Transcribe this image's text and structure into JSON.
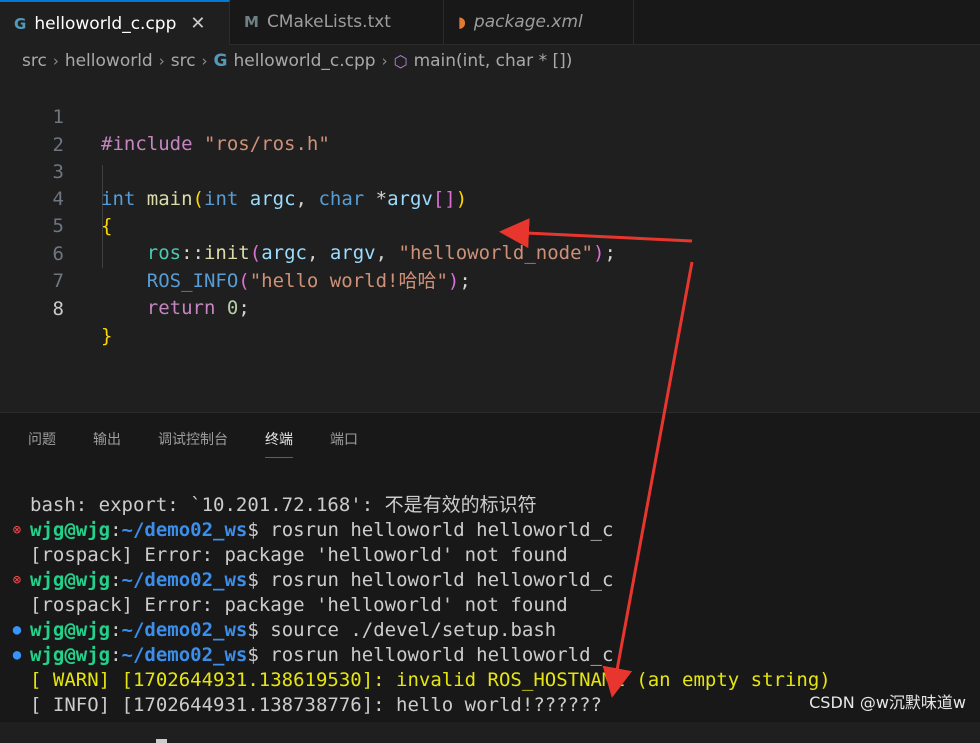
{
  "tabs": [
    {
      "icon": "G",
      "label": "helloworld_c.cpp",
      "close": "✕"
    },
    {
      "icon": "M",
      "label": "CMakeLists.txt"
    },
    {
      "icon": "◗",
      "label": "package.xml"
    }
  ],
  "breadcrumb": {
    "parts": [
      "src",
      "helloworld",
      "src",
      "helloworld_c.cpp",
      "main(int, char * [])"
    ],
    "file_icon": "G",
    "symbol_icon": "⬡",
    "separator": "›"
  },
  "editor": {
    "line_numbers": [
      "1",
      "2",
      "3",
      "4",
      "5",
      "6",
      "7",
      "8"
    ],
    "l1": {
      "directive": "#include",
      "path": "\"ros/ros.h\""
    },
    "l3": {
      "int1": "int",
      "main": "main",
      "lp": "(",
      "int2": "int",
      "argc": "argc",
      "comma": ", ",
      "char": "char",
      "star": " *",
      "argv": "argv",
      "br": "[]",
      "rp": ")"
    },
    "l4": {
      "brace": "{"
    },
    "l5": {
      "ns": "ros",
      "sep": "::",
      "fn": "init",
      "lp": "(",
      "a1": "argc",
      "c1": ", ",
      "a2": "argv",
      "c2": ", ",
      "str": "\"helloworld_node\"",
      "rp": ")",
      "semi": ";"
    },
    "l6": {
      "macro": "ROS_INFO",
      "lp": "(",
      "str": "\"hello world!哈哈\"",
      "rp": ")",
      "semi": ";"
    },
    "l7": {
      "ret": "return",
      "num": "0",
      "semi": ";"
    },
    "l8": {
      "brace": "}"
    }
  },
  "panel": {
    "tabs": [
      "问题",
      "输出",
      "调试控制台",
      "终端",
      "端口"
    ],
    "active_tab": "终端"
  },
  "terminal": {
    "lines": [
      {
        "text": "bash: export: `10.201.72.168': 不是有效的标识符"
      },
      {
        "user": "wjg@wjg",
        "colon": ":",
        "path": "~/demo02_ws",
        "cmd": "$ rosrun helloworld helloworld_c"
      },
      {
        "text": "[rospack] Error: package 'helloworld' not found"
      },
      {
        "user": "wjg@wjg",
        "colon": ":",
        "path": "~/demo02_ws",
        "cmd": "$ rosrun helloworld helloworld_c"
      },
      {
        "text": "[rospack] Error: package 'helloworld' not found"
      },
      {
        "user": "wjg@wjg",
        "colon": ":",
        "path": "~/demo02_ws",
        "cmd": "$ source ./devel/setup.bash"
      },
      {
        "user": "wjg@wjg",
        "colon": ":",
        "path": "~/demo02_ws",
        "cmd": "$ rosrun helloworld helloworld_c"
      },
      {
        "text": "[ WARN] [1702644931.138619530]: invalid ROS_HOSTNAME (an empty string)"
      },
      {
        "text": "[ INFO] [1702644931.138738776]: hello world!??????"
      }
    ],
    "status_icons": {
      "error": "⊗",
      "success": "●"
    }
  },
  "watermark": "CSDN @w沉默味道w",
  "colors": {
    "annotation_arrow": "#e8362f",
    "accent": "#0078d4"
  }
}
